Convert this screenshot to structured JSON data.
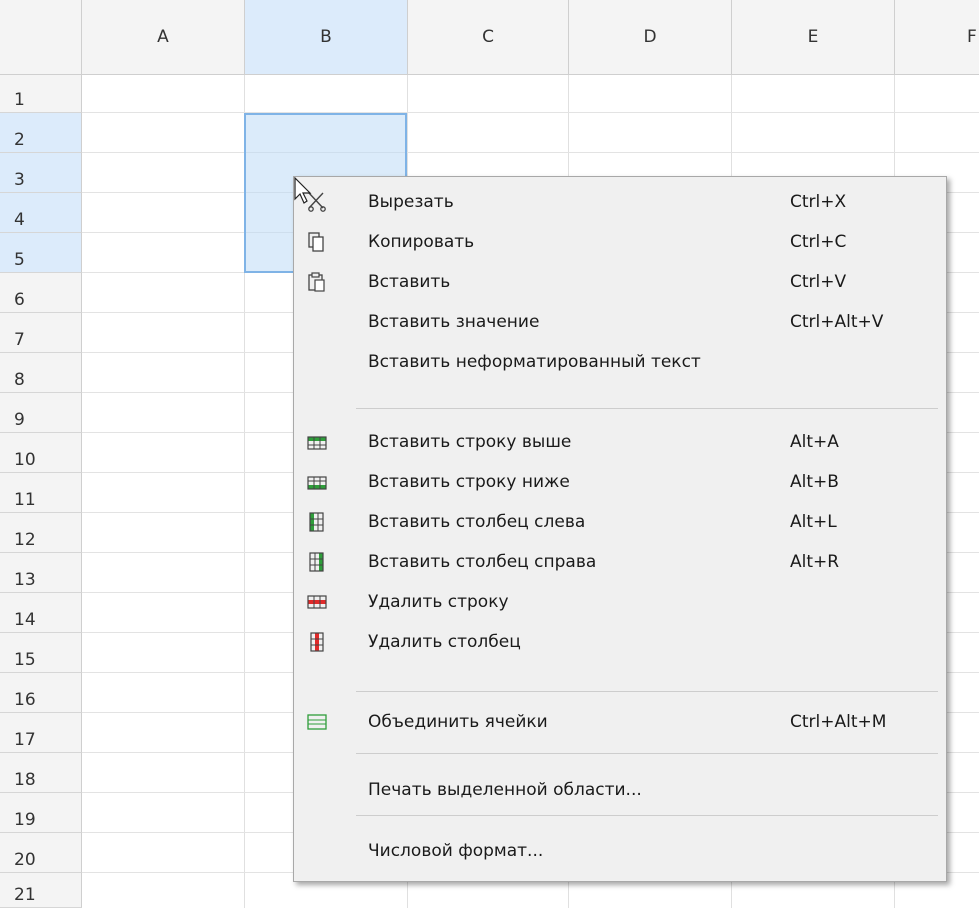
{
  "columns": [
    "A",
    "B",
    "C",
    "D",
    "E",
    "F"
  ],
  "selected_column": "B",
  "rows": [
    "1",
    "2",
    "3",
    "4",
    "5",
    "6",
    "7",
    "8",
    "9",
    "10",
    "11",
    "12",
    "13",
    "14",
    "15",
    "16",
    "17",
    "18",
    "19",
    "20",
    "21"
  ],
  "selected_rows": [
    "2",
    "3",
    "4",
    "5"
  ],
  "context_menu": {
    "cut": {
      "label": "Вырезать",
      "shortcut": "Ctrl+X",
      "icon": "scissors-icon"
    },
    "copy": {
      "label": "Копировать",
      "shortcut": "Ctrl+C",
      "icon": "copy-icon"
    },
    "paste": {
      "label": "Вставить",
      "shortcut": "Ctrl+V",
      "icon": "paste-icon"
    },
    "paste_value": {
      "label": "Вставить значение",
      "shortcut": "Ctrl+Alt+V"
    },
    "paste_unformatted": {
      "label": "Вставить неформатированный текст"
    },
    "insert_row_above": {
      "label": "Вставить строку выше",
      "shortcut": "Alt+A",
      "icon": "insert-row-above-icon"
    },
    "insert_row_below": {
      "label": "Вставить строку ниже",
      "shortcut": "Alt+B",
      "icon": "insert-row-below-icon"
    },
    "insert_col_left": {
      "label": "Вставить столбец слева",
      "shortcut": "Alt+L",
      "icon": "insert-column-left-icon"
    },
    "insert_col_right": {
      "label": "Вставить столбец справа",
      "shortcut": "Alt+R",
      "icon": "insert-column-right-icon"
    },
    "delete_row": {
      "label": "Удалить строку",
      "icon": "delete-row-icon"
    },
    "delete_col": {
      "label": "Удалить столбец",
      "icon": "delete-column-icon"
    },
    "merge_cells": {
      "label": "Объединить ячейки",
      "shortcut": "Ctrl+Alt+M",
      "icon": "merge-cells-icon"
    },
    "print_selection": {
      "label": "Печать выделенной области..."
    },
    "number_format": {
      "label": "Числовой формат..."
    }
  },
  "colors": {
    "header_bg": "#f4f4f4",
    "selected_header_bg": "#dcebfb",
    "selection_border": "#7fb3e6",
    "menu_bg": "#f0f0f0",
    "green_icon": "#2e9e3a",
    "red_icon": "#e02a2a"
  }
}
